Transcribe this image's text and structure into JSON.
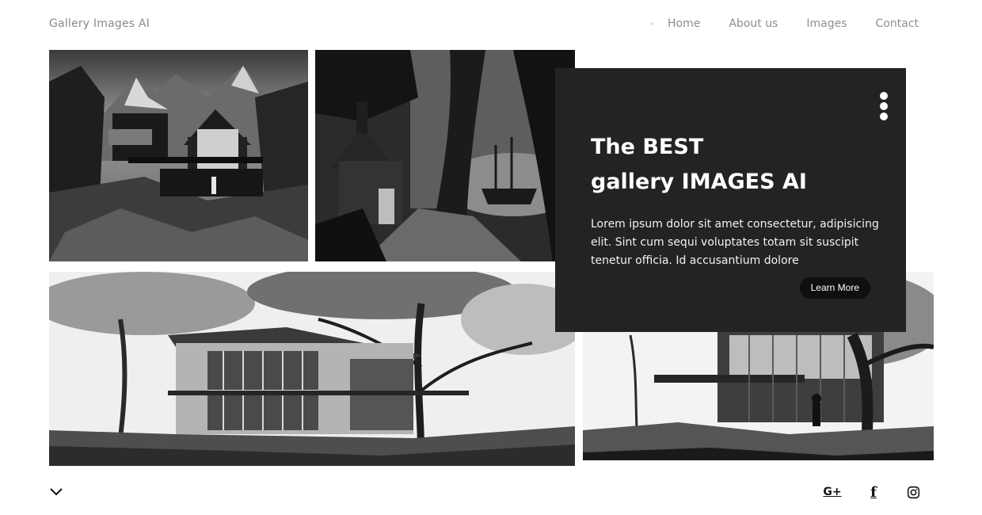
{
  "header": {
    "brand": "Gallery Images AI",
    "nav": [
      "Home",
      "About us",
      "Images",
      "Contact"
    ]
  },
  "card": {
    "title_line1": "The BEST",
    "title_line2": "gallery IMAGES AI",
    "body": "Lorem ipsum dolor sit amet consectetur, adipisicing elit. Sint cum sequi voluptates totam sit suscipit tenetur officia. Id accusantium dolore",
    "cta_label": "Learn More"
  },
  "footer": {
    "social": [
      "G+",
      "f"
    ]
  },
  "icons": {
    "menu": "kebab-menu-icon",
    "scroll": "chevron-down-icon",
    "google_plus": "google-plus-icon",
    "facebook": "facebook-icon",
    "instagram": "instagram-icon"
  },
  "colors": {
    "card_background": "#232323",
    "button_background": "#0f0f0f",
    "nav_text": "#8f8f8f"
  }
}
